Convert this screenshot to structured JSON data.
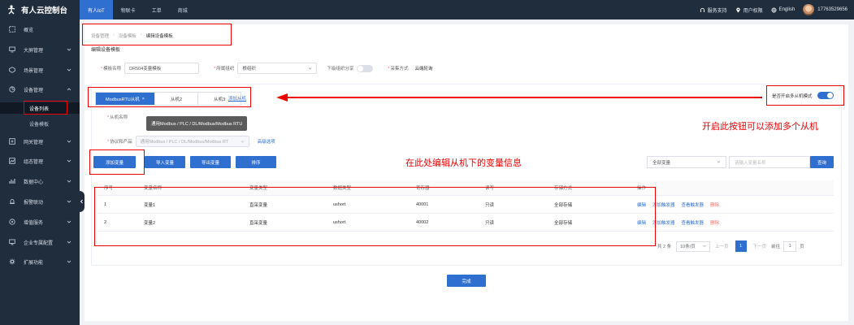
{
  "brand": {
    "name": "有人云控制台"
  },
  "topnav": [
    {
      "label": "有人IoT",
      "active": true
    },
    {
      "label": "物联卡",
      "active": false
    },
    {
      "label": "工单",
      "active": false
    },
    {
      "label": "商城",
      "active": false
    }
  ],
  "topright": {
    "support": "服务支持",
    "location": "用户权限",
    "language": "English",
    "phone": "17763529656"
  },
  "sidebar": {
    "items": [
      {
        "label": "概览",
        "icon": "overview-icon"
      },
      {
        "label": "大屏管理",
        "icon": "screen-icon"
      },
      {
        "label": "场景管理",
        "icon": "scene-icon"
      },
      {
        "label": "设备管理",
        "icon": "device-icon"
      },
      {
        "label": "网关管理",
        "icon": "gateway-icon"
      },
      {
        "label": "组态管理",
        "icon": "config-icon"
      },
      {
        "label": "数据中心",
        "icon": "data-icon"
      },
      {
        "label": "报警联动",
        "icon": "alarm-icon"
      },
      {
        "label": "增值服务",
        "icon": "service-icon"
      },
      {
        "label": "企业专属配置",
        "icon": "enterprise-icon"
      },
      {
        "label": "扩展功能",
        "icon": "extension-icon"
      }
    ],
    "sub": [
      {
        "label": "设备列表",
        "active": true
      },
      {
        "label": "设备模板",
        "active": false
      }
    ]
  },
  "breadcrumb": [
    "设备管理",
    "设备模板",
    "编辑设备模板"
  ],
  "section_title": "编辑设备模板",
  "form": {
    "template_name_label": "模板名称",
    "template_name_value": "DR504变量模板",
    "org_label": "所属组织",
    "org_value": "根组织",
    "share_label": "下级组织分享",
    "collect_label": "采集方式",
    "collect_value": "云端轮询"
  },
  "slave_tabs": [
    {
      "label": "ModbusRTU从机",
      "active": true
    },
    {
      "label": "从机2",
      "active": false
    },
    {
      "label": "从机3",
      "active": false
    }
  ],
  "add_slave": "添加从机",
  "multi_slave_label": "是否开启多从机模式",
  "slave_name_label": "从机名称",
  "protocol_label": "协议和产品",
  "protocol_value": "通用Modbus / PLC / DL/Modbus/Modbus RT",
  "tooltip_text": "通用Modbus / PLC / DL/Modbus/Modbus RTU",
  "advanced_link": "高级选项",
  "buttons": {
    "add_var": "添加变量",
    "import_var": "导入变量",
    "export_var": "导出变量",
    "sort": "排序",
    "query": "查询",
    "done": "完成"
  },
  "filter": {
    "select_value": "全部变量",
    "input_placeholder": "请输入变量名称"
  },
  "table": {
    "headers": [
      "序号",
      "变量名称",
      "变量类型",
      "数据类型",
      "寄存器",
      "读写",
      "存储方式",
      "操作"
    ],
    "rows": [
      {
        "index": "1",
        "name": "变量1",
        "type": "直采变量",
        "dtype": "ushort",
        "register": "40001",
        "rw": "只读",
        "storage": "全部存储"
      },
      {
        "index": "2",
        "name": "变量2",
        "type": "直采变量",
        "dtype": "ushort",
        "register": "40002",
        "rw": "只读",
        "storage": "全部存储"
      }
    ],
    "ops": {
      "edit": "编辑",
      "add_trigger": "添加触发器",
      "view_trigger": "查看触发器",
      "delete": "删除"
    }
  },
  "pager": {
    "total": "共 2 条",
    "page_size": "10条/页",
    "prev": "上一页",
    "current": "1",
    "next": "下一页",
    "goto": "前往",
    "goto_value": "1",
    "page_unit": "页"
  },
  "annotations": {
    "multi_slave_note": "开启此按钮可以添加多个从机",
    "edit_var_note": "在此处编辑从机下的变量信息"
  },
  "colors": {
    "sidebar": "#1f2d3d",
    "primary": "#2f6fd0",
    "annotation": "#e00000"
  }
}
